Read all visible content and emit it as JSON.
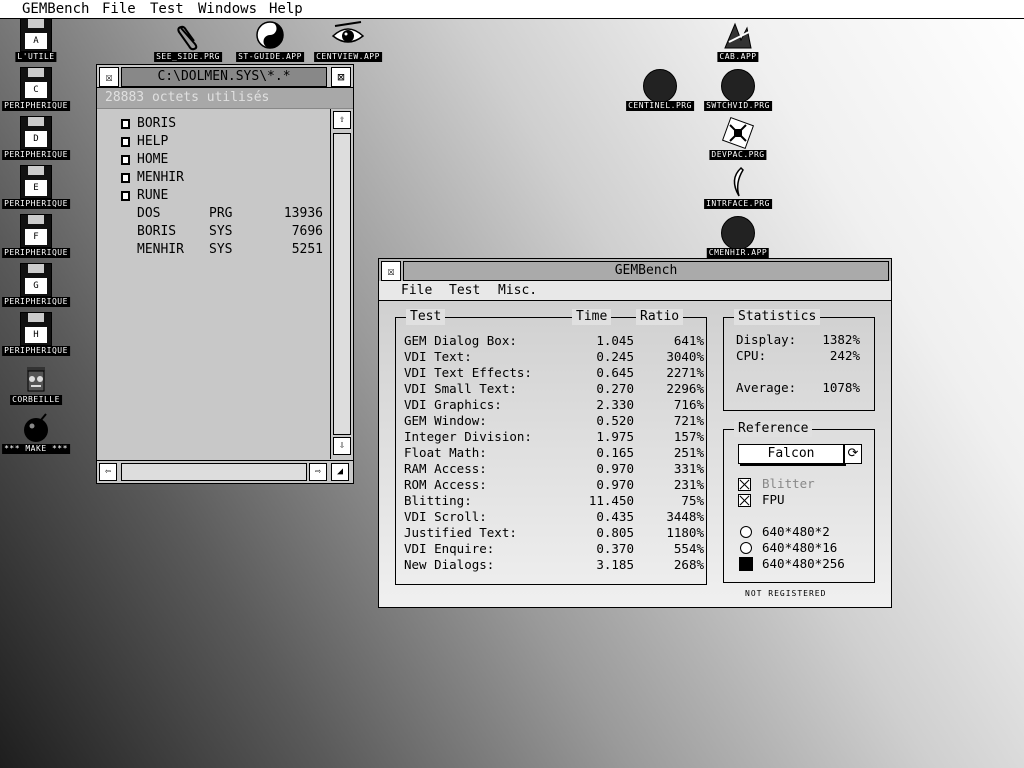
{
  "menubar": {
    "app": "GEMBench",
    "items": [
      "File",
      "Test",
      "Windows",
      "Help"
    ]
  },
  "desktop": {
    "drives": [
      {
        "letter": "A",
        "label": "L'UTILE"
      },
      {
        "letter": "C",
        "label": "PERIPHERIQUE"
      },
      {
        "letter": "D",
        "label": "PERIPHERIQUE"
      },
      {
        "letter": "E",
        "label": "PERIPHERIQUE"
      },
      {
        "letter": "F",
        "label": "PERIPHERIQUE"
      },
      {
        "letter": "G",
        "label": "PERIPHERIQUE"
      },
      {
        "letter": "H",
        "label": "PERIPHERIQUE"
      }
    ],
    "trash_label": "CORBEILLE",
    "make_label": "*** MAKE ***",
    "top_apps": [
      "SEE_SIDE.PRG",
      "ST-GUIDE.APP",
      "CENTVIEW.APP"
    ],
    "right_apps": [
      "CAB.APP",
      "CENTINEL.PRG",
      "SWTCHVID.PRG",
      "DEVPAC.PRG",
      "INTRFACE.PRG",
      "CMENHIR.APP"
    ]
  },
  "dirwin": {
    "close_glyph": "☒",
    "full_glyph": "⊠",
    "title": "C:\\DOLMEN.SYS\\*.*",
    "info": "28883 octets utilisés",
    "folders": [
      "BORIS",
      "HELP",
      "HOME",
      "MENHIR",
      "RUNE"
    ],
    "files": [
      {
        "name": "DOS",
        "ext": "PRG",
        "size": "13936"
      },
      {
        "name": "BORIS",
        "ext": "SYS",
        "size": "7696"
      },
      {
        "name": "MENHIR",
        "ext": "SYS",
        "size": "5251"
      }
    ],
    "up_arrow": "⇧",
    "down_arrow": "⇩",
    "left_arrow": "⇦",
    "right_arrow": "⇨",
    "size_glyph": "◢"
  },
  "gembench": {
    "title": "GEMBench",
    "close_glyph": "☒",
    "menu": [
      "File",
      "Test",
      "Misc."
    ],
    "tests_header": {
      "test": "Test",
      "time": "Time",
      "ratio": "Ratio"
    },
    "tests": [
      {
        "name": "GEM Dialog Box:",
        "time": "1.045",
        "ratio": "641%"
      },
      {
        "name": "VDI Text:",
        "time": "0.245",
        "ratio": "3040%"
      },
      {
        "name": "VDI Text Effects:",
        "time": "0.645",
        "ratio": "2271%"
      },
      {
        "name": "VDI Small Text:",
        "time": "0.270",
        "ratio": "2296%"
      },
      {
        "name": "VDI Graphics:",
        "time": "2.330",
        "ratio": "716%"
      },
      {
        "name": "GEM Window:",
        "time": "0.520",
        "ratio": "721%"
      },
      {
        "name": "Integer Division:",
        "time": "1.975",
        "ratio": "157%"
      },
      {
        "name": "Float Math:",
        "time": "0.165",
        "ratio": "251%"
      },
      {
        "name": "RAM Access:",
        "time": "0.970",
        "ratio": "331%"
      },
      {
        "name": "ROM Access:",
        "time": "0.970",
        "ratio": "231%"
      },
      {
        "name": "Blitting:",
        "time": "11.450",
        "ratio": "75%"
      },
      {
        "name": "VDI Scroll:",
        "time": "0.435",
        "ratio": "3448%"
      },
      {
        "name": "Justified Text:",
        "time": "0.805",
        "ratio": "1180%"
      },
      {
        "name": "VDI Enquire:",
        "time": "0.370",
        "ratio": "554%"
      },
      {
        "name": "New Dialogs:",
        "time": "3.185",
        "ratio": "268%"
      }
    ],
    "statistics": {
      "header": "Statistics",
      "display_label": "Display:",
      "display_value": "1382%",
      "cpu_label": "CPU:",
      "cpu_value": "242%",
      "average_label": "Average:",
      "average_value": "1078%"
    },
    "reference": {
      "header": "Reference",
      "selected": "Falcon",
      "cycle_glyph": "⟳",
      "checks": [
        {
          "label": "Blitter",
          "checked": true,
          "disabled": true
        },
        {
          "label": "FPU",
          "checked": true,
          "disabled": false
        }
      ],
      "modes": [
        {
          "label": "640*480*2",
          "selected": false
        },
        {
          "label": "640*480*16",
          "selected": false
        },
        {
          "label": "640*480*256",
          "selected": true
        }
      ]
    },
    "footer": "NOT REGISTERED"
  }
}
